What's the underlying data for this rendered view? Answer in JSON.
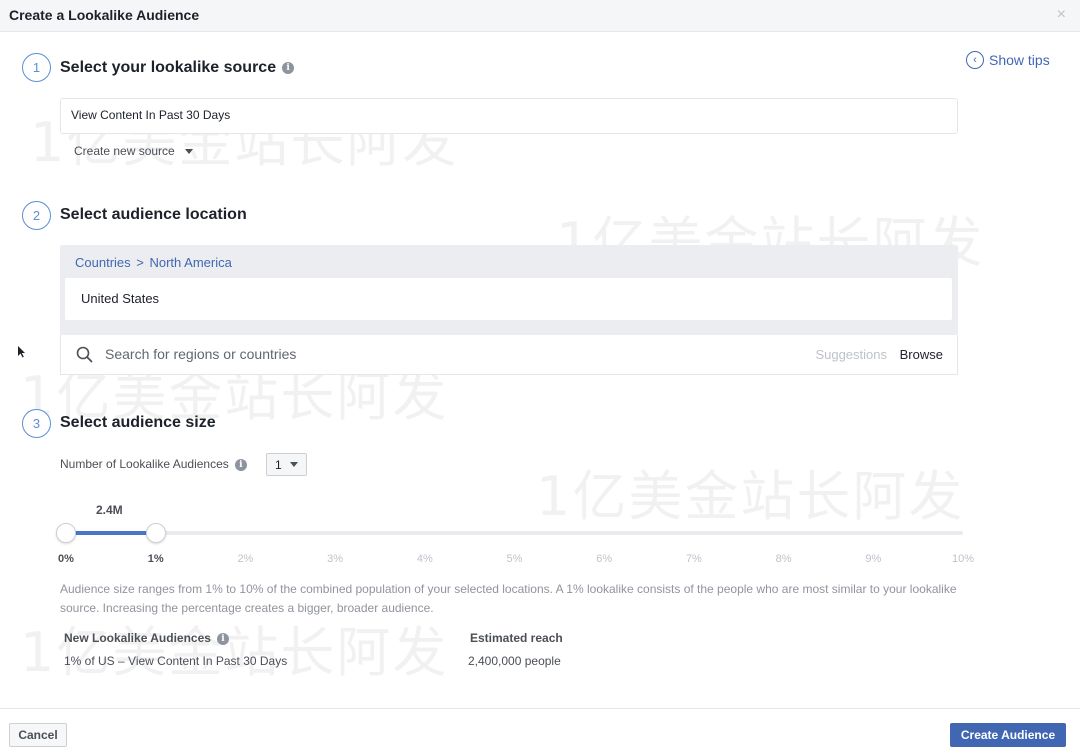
{
  "dialog": {
    "title": "Create a Lookalike Audience",
    "close_glyph": "×"
  },
  "tips": {
    "label": "Show tips"
  },
  "step1": {
    "number": "1",
    "title": "Select your lookalike source",
    "source_value": "View Content In Past 30 Days",
    "create_source_label": "Create new source"
  },
  "step2": {
    "number": "2",
    "title": "Select audience location",
    "breadcrumb_parent": "Countries",
    "breadcrumb_separator": ">",
    "breadcrumb_child": "North America",
    "selected_country": "United States",
    "search_placeholder": "Search for regions or countries",
    "suggestions_label": "Suggestions",
    "browse_label": "Browse"
  },
  "step3": {
    "number": "3",
    "title": "Select audience size",
    "num_audiences_label": "Number of Lookalike Audiences",
    "num_audiences_value": "1",
    "estimated_size": "2.4M",
    "slider_min_percent": 0,
    "slider_max_percent": 10,
    "slider_selected_percent": 1,
    "ticks": [
      "0%",
      "1%",
      "2%",
      "3%",
      "4%",
      "5%",
      "6%",
      "7%",
      "8%",
      "9%",
      "10%"
    ],
    "description": "Audience size ranges from 1% to 10% of the combined population of your selected locations. A 1% lookalike consists of the people who are most similar to your lookalike source. Increasing the percentage creates a bigger, broader audience.",
    "new_audiences_header": "New Lookalike Audiences",
    "new_audience_value": "1% of US – View Content In Past 30 Days",
    "reach_header": "Estimated reach",
    "reach_value": "2,400,000 people"
  },
  "footer": {
    "cancel_label": "Cancel",
    "create_label": "Create Audience"
  },
  "watermark": {
    "text": "1亿美金站长阿发"
  },
  "colors": {
    "accent": "#4267b2",
    "step_circle": "#5b8fd6",
    "slider_fill": "#4a76c8"
  }
}
